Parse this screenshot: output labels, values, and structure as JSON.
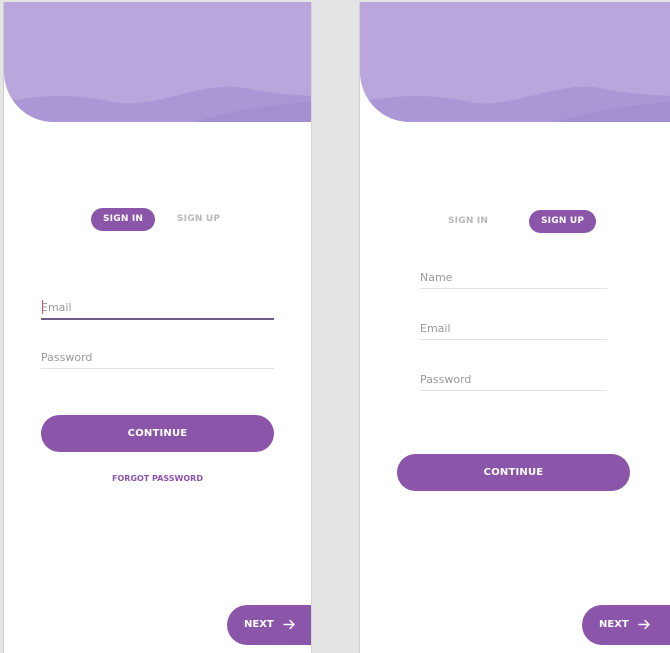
{
  "colors": {
    "accent": "#8b55aa",
    "header_light": "#b8a6dd",
    "header_wave": "#ab97d6",
    "header_wave_dark": "#a48fd1"
  },
  "signin_screen": {
    "tabs": {
      "sign_in": "SIGN IN",
      "sign_up": "SIGN UP"
    },
    "email_placeholder": "Email",
    "password_placeholder": "Password",
    "continue_label": "CONTINUE",
    "forgot_label": "FORGOT PASSWORD",
    "next_label": "NEXT",
    "next_icon": "arrow-right-icon"
  },
  "signup_screen": {
    "tabs": {
      "sign_in": "SIGN IN",
      "sign_up": "SIGN UP"
    },
    "name_placeholder": "Name",
    "email_placeholder": "Email",
    "password_placeholder": "Password",
    "continue_label": "CONTINUE",
    "next_label": "NEXT",
    "next_icon": "arrow-right-icon"
  }
}
